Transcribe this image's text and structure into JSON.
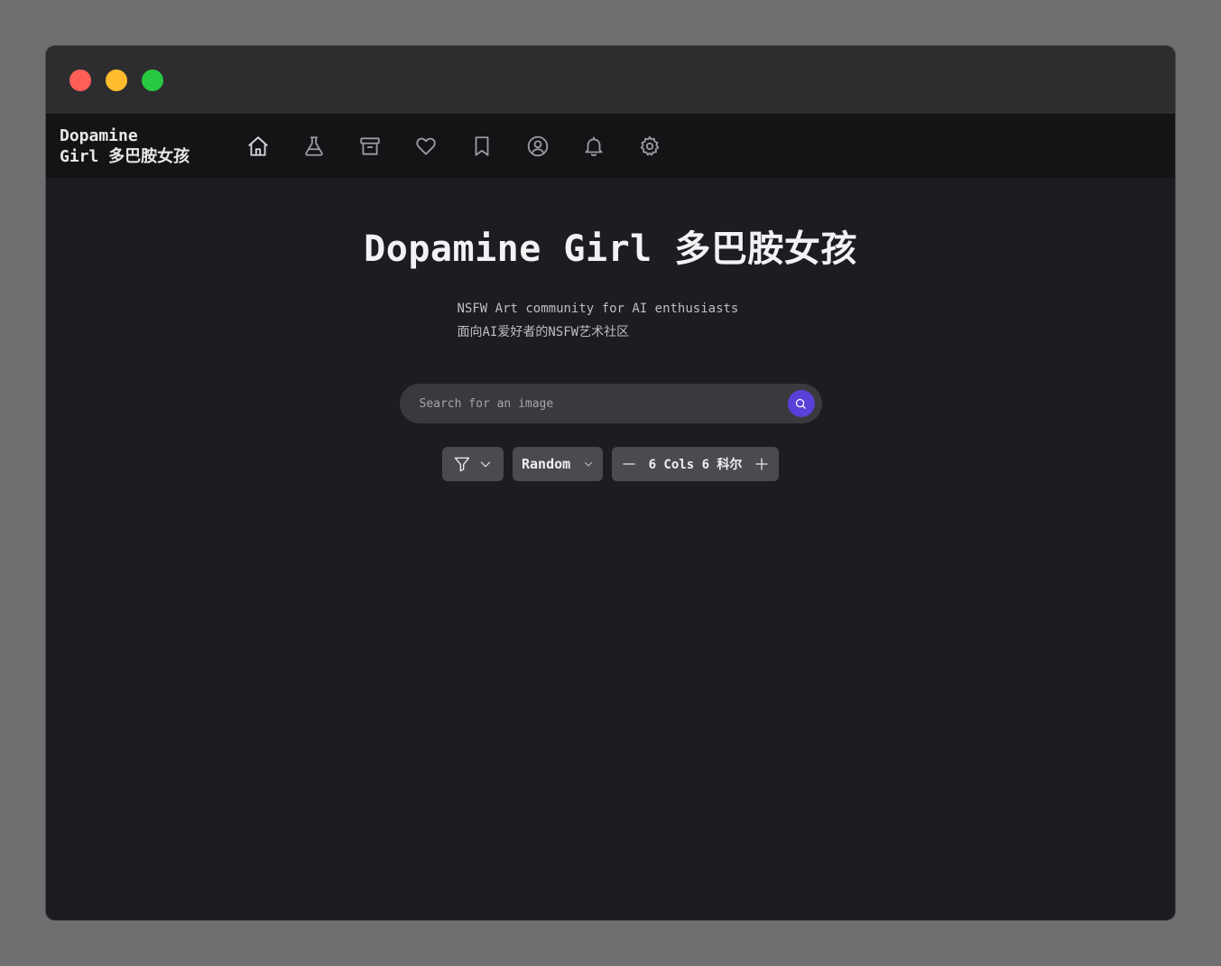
{
  "navbar": {
    "brand_line1": "Dopamine",
    "brand_line2": "Girl 多巴胺女孩",
    "icons": [
      "home-icon",
      "flask-icon",
      "archive-icon",
      "heart-icon",
      "bookmark-icon",
      "user-icon",
      "bell-icon",
      "gear-icon"
    ]
  },
  "hero": {
    "title": "Dopamine Girl 多巴胺女孩",
    "subtitle_en": "NSFW Art community for AI enthusiasts",
    "subtitle_zh": "面向AI爱好者的NSFW艺术社区"
  },
  "search": {
    "placeholder": "Search for an image"
  },
  "controls": {
    "sort_label": "Random",
    "cols_label": "6 Cols 6 科尔"
  },
  "colors": {
    "accent": "#5a3fd8",
    "background": "#1d1c20",
    "navbar": "#141416"
  }
}
